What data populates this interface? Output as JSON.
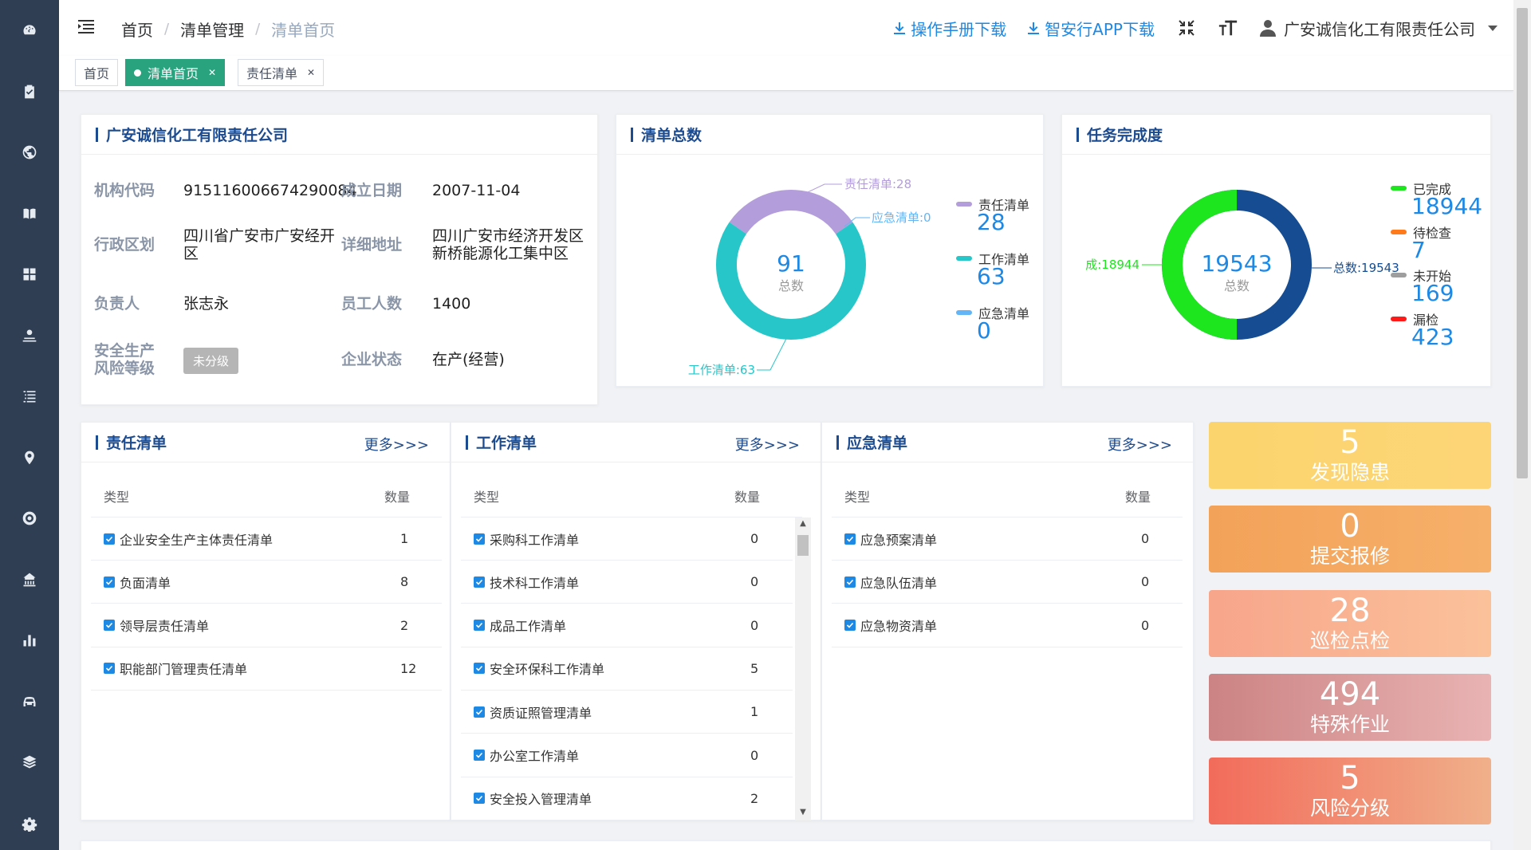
{
  "sidebar": {
    "icons": [
      "dashboard-icon",
      "checklist-icon",
      "globe-icon",
      "book-icon",
      "grid-icon",
      "inspect-icon",
      "list-icon",
      "location-icon",
      "target-icon",
      "enterprise-icon",
      "bar-chart-icon",
      "car-icon",
      "layers-icon",
      "settings-icon"
    ]
  },
  "header": {
    "breadcrumb": [
      "首页",
      "清单管理",
      "清单首页"
    ],
    "manual_download": "操作手册下载",
    "app_download": "智安行APP下载",
    "user_name": "广安诚信化工有限责任公司"
  },
  "tabs": [
    {
      "label": "首页",
      "active": false,
      "closable": false
    },
    {
      "label": "清单首页",
      "active": true,
      "closable": true
    },
    {
      "label": "责任清单",
      "active": false,
      "closable": true
    }
  ],
  "company": {
    "title": "广安诚信化工有限责任公司",
    "labels": {
      "code": "机构代码",
      "founded": "成立日期",
      "region": "行政区划",
      "address": "详细地址",
      "owner": "负责人",
      "employees": "员工人数",
      "risk1": "安全生产",
      "risk2": "风险等级",
      "status": "企业状态"
    },
    "values": {
      "code": "915116006674290084",
      "founded": "2007-11-04",
      "region": "四川省广安市广安经开区",
      "address": "四川广安市经济开发区新桥能源化工集中区",
      "owner": "张志永",
      "employees": "1400",
      "risk": "未分级",
      "status": "在产(经营)"
    }
  },
  "list_total": {
    "title": "清单总数",
    "center_value": "91",
    "center_label": "总数",
    "colors": {
      "responsibility": "#b39ddb",
      "work": "#26c6c9",
      "emergency": "#64b5f6"
    },
    "callouts": {
      "responsibility": "责任清单:28",
      "emergency": "应急清单:0",
      "work": "工作清单:63"
    },
    "legend": [
      {
        "name": "责任清单",
        "value": "28"
      },
      {
        "name": "工作清单",
        "value": "63"
      },
      {
        "name": "应急清单",
        "value": "0"
      }
    ]
  },
  "task_completion": {
    "title": "任务完成度",
    "center_value": "19543",
    "center_label": "总数",
    "colors": {
      "done": "#1ee61e",
      "pending": "#ff7a1a",
      "not_started": "#9e9e9e",
      "missed": "#ff1a1a",
      "total": "#154c92"
    },
    "callouts": {
      "left": "成:18944",
      "right": "总数:19543"
    },
    "legend": [
      {
        "name": "已完成",
        "value": "18944"
      },
      {
        "name": "待检查",
        "value": "7"
      },
      {
        "name": "未开始",
        "value": "169"
      },
      {
        "name": "漏检",
        "value": "423"
      }
    ]
  },
  "tables": {
    "more_label": "更多>>>",
    "col_type": "类型",
    "col_count": "数量",
    "responsibility": {
      "title": "责任清单",
      "rows": [
        {
          "name": "企业安全生产主体责任清单",
          "count": "1"
        },
        {
          "name": "负面清单",
          "count": "8"
        },
        {
          "name": "领导层责任清单",
          "count": "2"
        },
        {
          "name": "职能部门管理责任清单",
          "count": "12"
        }
      ]
    },
    "work": {
      "title": "工作清单",
      "rows": [
        {
          "name": "采购科工作清单",
          "count": "0"
        },
        {
          "name": "技术科工作清单",
          "count": "0"
        },
        {
          "name": "成品工作清单",
          "count": "0"
        },
        {
          "name": "安全环保科工作清单",
          "count": "5"
        },
        {
          "name": "资质证照管理清单",
          "count": "1"
        },
        {
          "name": "办公室工作清单",
          "count": "0"
        },
        {
          "name": "安全投入管理清单",
          "count": "2"
        }
      ]
    },
    "emergency": {
      "title": "应急清单",
      "rows": [
        {
          "name": "应急预案清单",
          "count": "0"
        },
        {
          "name": "应急队伍清单",
          "count": "0"
        },
        {
          "name": "应急物资清单",
          "count": "0"
        }
      ]
    }
  },
  "tiles": [
    {
      "value": "5",
      "label": "发现隐患",
      "from": "#fbd46d",
      "to": "#fdd577"
    },
    {
      "value": "0",
      "label": "提交报修",
      "from": "#f3a259",
      "to": "#f6b06a"
    },
    {
      "value": "28",
      "label": "巡检点检",
      "from": "#f7a58b",
      "to": "#fbc29a"
    },
    {
      "value": "494",
      "label": "特殊作业",
      "from": "#cc8383",
      "to": "#e9b3b3"
    },
    {
      "value": "5",
      "label": "风险分级",
      "from": "#f26b5b",
      "to": "#f0b08a"
    }
  ]
}
